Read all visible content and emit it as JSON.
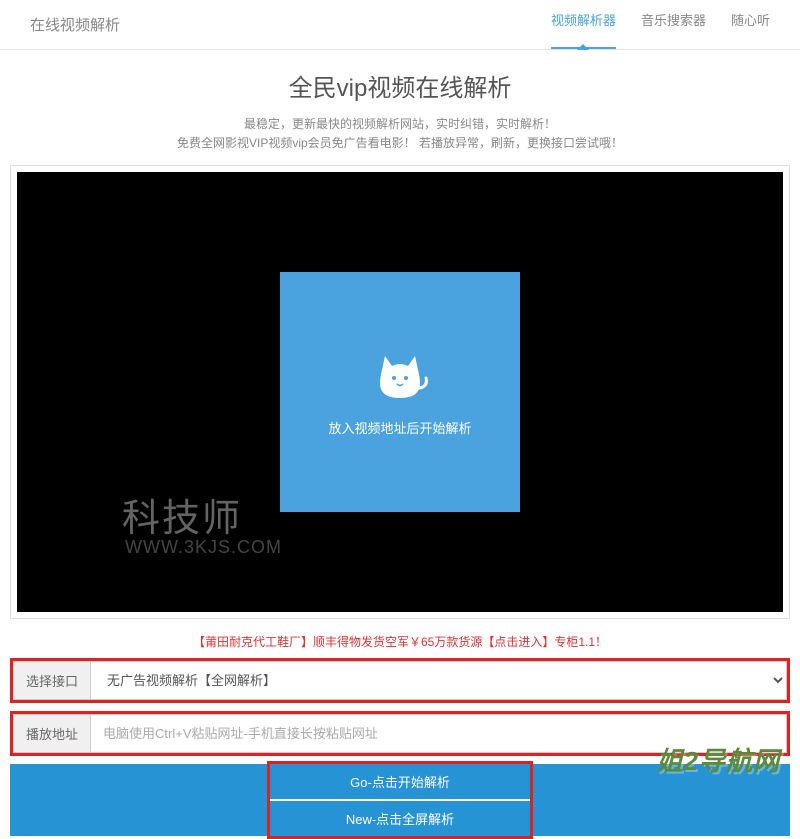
{
  "navbar": {
    "brand": "在线视频解析",
    "links": [
      {
        "label": "视频解析器",
        "active": true
      },
      {
        "label": "音乐搜索器",
        "active": false
      },
      {
        "label": "随心听",
        "active": false
      }
    ]
  },
  "title": "全民vip视频在线解析",
  "subtitle_line1": "最稳定，更新最快的视频解析网站，实时纠错，实时解析！",
  "subtitle_line2": "免费全网影视VIP视频vip会员免广告看电影！ 若播放异常，刷新，更换接口尝试哦！",
  "player": {
    "hint": "放入视频地址后开始解析"
  },
  "watermark": {
    "brand": "科技师",
    "url": "WWW.3KJS.COM",
    "footer": "姐2导航网"
  },
  "promo": "【莆田耐克代工鞋厂】顺丰得物发货空军￥65万款货源【点击进入】专柜1.1！",
  "form": {
    "interface_label": "选择接口",
    "interface_value": "无广告视频解析【全网解析】",
    "address_label": "播放地址",
    "address_placeholder": "电脑使用Ctrl+V粘贴网址-手机直接长按粘贴网址"
  },
  "buttons": {
    "go": "Go-点击开始解析",
    "new": "New-点击全屏解析"
  }
}
